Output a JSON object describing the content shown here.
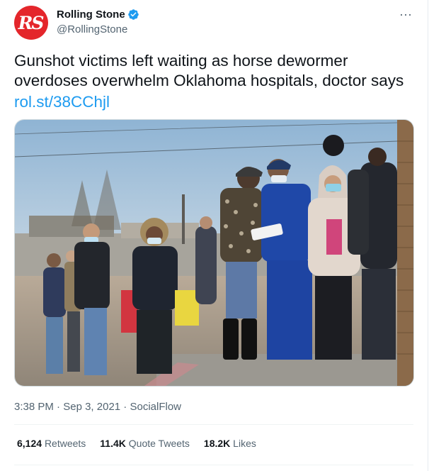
{
  "tweet": {
    "avatar_text": "RS",
    "display_name": "Rolling Stone",
    "handle": "@RollingStone",
    "more_icon": "···",
    "text": "Gunshot victims left waiting as horse dewormer overdoses overwhelm Oklahoma hospitals, doctor says",
    "link": "rol.st/38CChjl",
    "time": "3:38 PM",
    "dot": "·",
    "date": "Sep 3, 2021",
    "source": "SocialFlow"
  },
  "stats": {
    "retweets_count": "6,124",
    "retweets_label": "Retweets",
    "quotes_count": "11.4K",
    "quotes_label": "Quote Tweets",
    "likes_count": "18.2K",
    "likes_label": "Likes"
  },
  "colors": {
    "brand": "#e4262b",
    "link": "#1d9bf0",
    "verified": "#1d9bf0",
    "secondary_text": "#536471"
  },
  "icons": {
    "avatar": "rolling-stone-logo",
    "verified": "verified-badge-icon",
    "more": "more-horizontal-icon"
  }
}
